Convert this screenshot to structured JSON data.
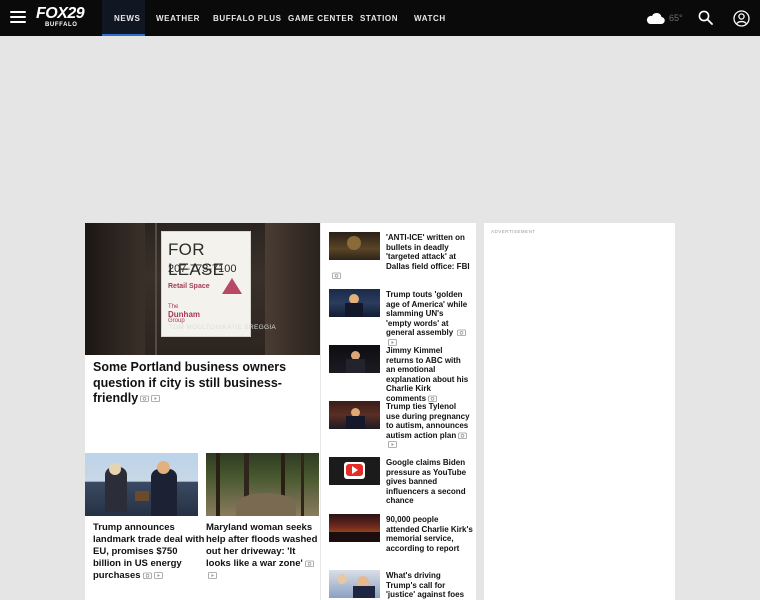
{
  "header": {
    "logo_top": "FOX29",
    "logo_bottom": "BUFFALO",
    "nav": [
      {
        "label": "NEWS"
      },
      {
        "label": "WEATHER"
      },
      {
        "label": "BUFFALO PLUS"
      },
      {
        "label": "GAME CENTER"
      },
      {
        "label": "STATION"
      },
      {
        "label": "WATCH"
      }
    ],
    "weather_temp": "65°",
    "accent_color": "#2f6ec8"
  },
  "hero": {
    "sign_for_lease": "FOR LEASE",
    "sign_phone": "207-773-7100",
    "sign_retail": "Retail Space",
    "sign_company_line1": "The",
    "sign_company_line2": "Dunham",
    "sign_company_line3": "Group",
    "photo_credit": "TOM MOULTON/KATIE BREGGIA",
    "title": "Some Portland business owners question if city is still business-friendly"
  },
  "secondary": [
    {
      "title": "Trump announces landmark trade deal with EU, promises $750 billion in US energy purchases"
    },
    {
      "title": "Maryland woman seeks help after floods washed out her driveway: 'It looks like a war zone'"
    }
  ],
  "sidebar": [
    {
      "title": "'ANTI-ICE' written on bullets in deadly 'targeted attack' at Dallas field office: FBI"
    },
    {
      "title": "Trump touts 'golden age of America' while slamming UN's 'empty words' at general assembly"
    },
    {
      "title": "Jimmy Kimmel returns to ABC with an emotional explanation about his Charlie Kirk comments"
    },
    {
      "title": "Trump ties Tylenol use during pregnancy to autism, announces autism action plan"
    },
    {
      "title": "Google claims Biden pressure as YouTube gives banned influencers a second chance"
    },
    {
      "title": "90,000 people attended Charlie Kirk's memorial service, according to report"
    },
    {
      "title": "What's driving Trump's call for 'justice' against foes"
    }
  ],
  "ad": {
    "label": "ADVERTISEMENT"
  }
}
